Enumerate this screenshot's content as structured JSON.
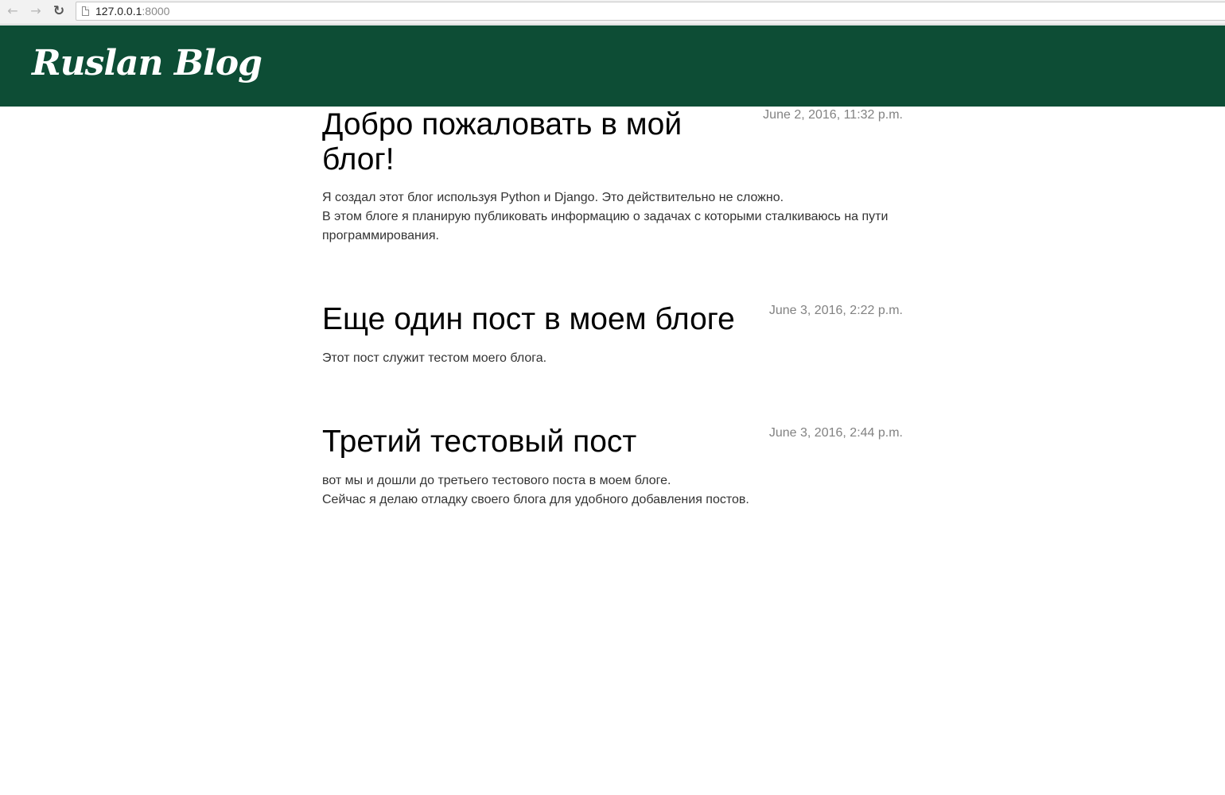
{
  "browser": {
    "back_icon": "arrow-left-icon",
    "forward_icon": "arrow-right-icon",
    "reload_icon": "reload-icon",
    "url_host": "127.0.0.1",
    "url_port": ":8000"
  },
  "header": {
    "title": "Ruslan Blog",
    "background_color": "#0d4d35"
  },
  "posts": [
    {
      "title": "Добро пожаловать в мой блог!",
      "date": "June 2, 2016, 11:32 p.m.",
      "lines": [
        "Я создал этот блог используя Python и Django. Это действительно не сложно.",
        "В этом блоге я планирую публиковать информацию о задачах с которыми сталкиваюсь на пути программирования."
      ]
    },
    {
      "title": "Еще один пост в моем блоге",
      "date": "June 3, 2016, 2:22 p.m.",
      "lines": [
        "Этот пост служит тестом моего блога."
      ]
    },
    {
      "title": "Третий тестовый пост",
      "date": "June 3, 2016, 2:44 p.m.",
      "lines": [
        "вот мы и дошли до третьего тестового поста в моем блоге.",
        "Сейчас я делаю отладку своего блога для удобного добавления постов."
      ]
    }
  ]
}
